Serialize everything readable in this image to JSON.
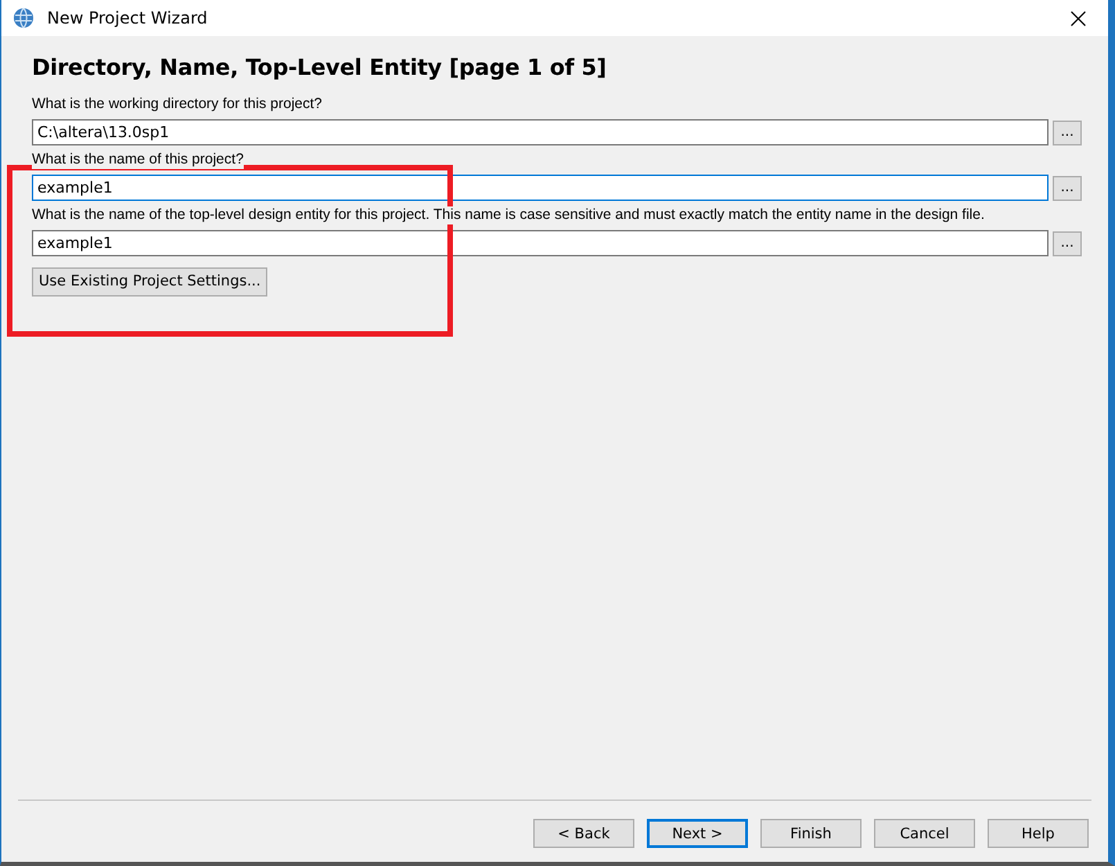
{
  "window": {
    "title": "New Project Wizard"
  },
  "heading": "Directory, Name, Top-Level Entity [page 1 of 5]",
  "fields": [
    {
      "label": "What is the working directory for this project?",
      "value": "C:\\altera\\13.0sp1",
      "focused": false,
      "browse": "..."
    },
    {
      "label": "What is the name of this project?",
      "value": "example1",
      "focused": true,
      "browse": "..."
    },
    {
      "label": "What is the name of the top-level design entity for this project. This name is case sensitive and must exactly match the entity name in the design file.",
      "value": "example1",
      "focused": false,
      "browse": "..."
    }
  ],
  "settings_button": "Use Existing Project Settings...",
  "buttons": [
    {
      "label": "< Back",
      "focused": false
    },
    {
      "label": "Next >",
      "focused": true
    },
    {
      "label": "Finish",
      "focused": false
    },
    {
      "label": "Cancel",
      "focused": false
    },
    {
      "label": "Help",
      "focused": false
    }
  ]
}
